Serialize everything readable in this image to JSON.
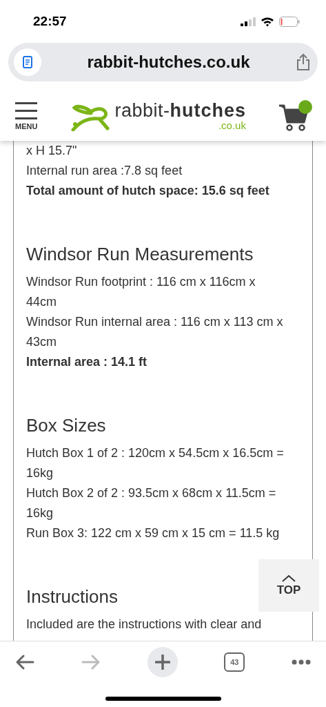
{
  "status_bar": {
    "time": "22:57"
  },
  "address_bar": {
    "url": "rabbit-hutches.co.uk"
  },
  "site_header": {
    "menu_label": "MENU",
    "logo_light": "rabbit-",
    "logo_bold": "hutches",
    "logo_domain": ".co.uk"
  },
  "sections": [
    {
      "lines": [
        {
          "kind": "text",
          "text": "x H 15.7\""
        },
        {
          "kind": "text",
          "text": "Internal run area :7.8 sq feet"
        },
        {
          "kind": "bold",
          "text": "Total amount of hutch space: 15.6 sq feet"
        }
      ]
    },
    {
      "heading": "Windsor Run Measurements",
      "lines": [
        {
          "kind": "text",
          "text": "Windsor Run footprint : 116 cm x 116cm x 44cm"
        },
        {
          "kind": "text",
          "text": "Windsor Run internal area : 116 cm x 113 cm x 43cm"
        },
        {
          "kind": "bold",
          "text": "Internal area : 14.1 ft"
        }
      ]
    },
    {
      "heading": "Box Sizes",
      "lines": [
        {
          "kind": "text",
          "text": "Hutch Box 1 of 2 : 120cm x 54.5cm x 16.5cm = 16kg"
        },
        {
          "kind": "text",
          "text": "Hutch Box 2 of 2 : 93.5cm x 68cm x 11.5cm = 16kg"
        },
        {
          "kind": "text",
          "text": "Run Box 3: 122 cm x 59 cm x 15 cm = 11.5 kg"
        }
      ]
    },
    {
      "heading": "Instructions",
      "lines": [
        {
          "kind": "text",
          "text": "Included are the instructions with clear and"
        }
      ]
    }
  ],
  "top_button": {
    "label": "TOP"
  },
  "toolbar": {
    "tab_count": "43"
  }
}
